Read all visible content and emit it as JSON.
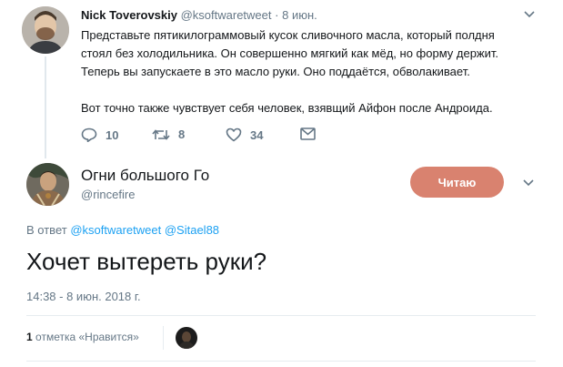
{
  "parent_tweet": {
    "author_name": "Nick Toverovskiy",
    "handle": "@ksoftwaretweet",
    "separator": "·",
    "date": "8 июн.",
    "text_lines": [
      "Представьте пятикилограммовый кусок сливочного масла, который полдня",
      "стоял без холодильника. Он совершенно мягкий как мёд, но форму держит.",
      "Теперь вы запускаете в это масло руки. Оно поддаётся, обволакивает."
    ],
    "text_line_last": "Вот точно также чувствует себя человек, взявщий Айфон после Андроида.",
    "actions": {
      "reply_count": "10",
      "retweet_count": "8",
      "like_count": "34"
    }
  },
  "reply_tweet": {
    "author_name": "Огни большого Го",
    "handle": "@rincefire",
    "follow_button": "Читаю",
    "in_reply_prefix": "В ответ",
    "in_reply_users": [
      "@ksoftwaretweet",
      "@Sitael88"
    ],
    "text": "Хочет вытереть руки?",
    "timestamp": "14:38 - 8 июн. 2018 г.",
    "likes_count": "1",
    "likes_label": "отметка «Нравится»"
  },
  "colors": {
    "link": "#1da1f2",
    "muted": "#657786",
    "follow_button_bg": "#d9826f"
  }
}
